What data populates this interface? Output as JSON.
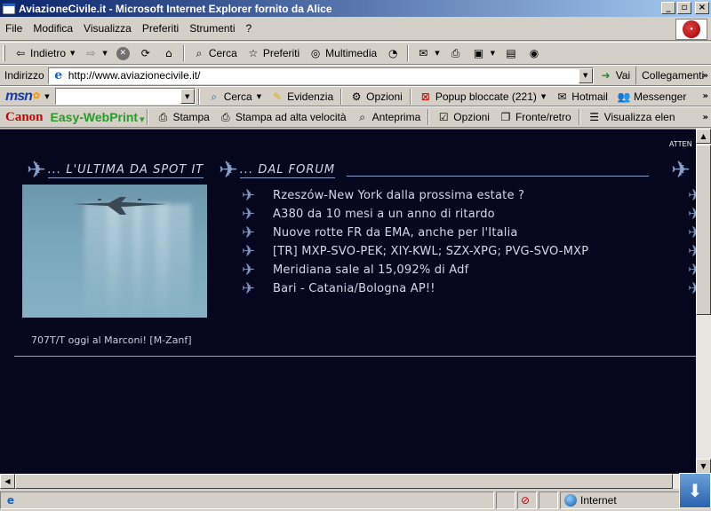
{
  "window": {
    "title": "AviazioneCivile.it - Microsoft Internet Explorer fornito da Alice",
    "controls": {
      "minimize": "_",
      "maximize": "▫",
      "close": "×"
    }
  },
  "menu": [
    "File",
    "Modifica",
    "Visualizza",
    "Preferiti",
    "Strumenti",
    "?"
  ],
  "std_toolbar": {
    "back": "Indietro",
    "search": "Cerca",
    "favorites": "Preferiti",
    "media": "Multimedia"
  },
  "address": {
    "label": "Indirizzo",
    "url": "http://www.aviazionecivile.it/",
    "go": "Vai",
    "links": "Collegamenti"
  },
  "msn_toolbar": {
    "logo": "msn",
    "search_value": "",
    "search": "Cerca",
    "highlight": "Evidenzia",
    "options": "Opzioni",
    "popup": "Popup bloccate (221)",
    "hotmail": "Hotmail",
    "messenger": "Messenger"
  },
  "canon_toolbar": {
    "logo": "Canon",
    "product": "Easy-WebPrint",
    "print": "Stampa",
    "fast_print": "Stampa ad alta velocità",
    "preview": "Anteprima",
    "options": "Opzioni",
    "duplex": "Fronte/retro",
    "view": "Visualizza elen"
  },
  "page": {
    "atten": "ATTEN",
    "spot_section": "... L'ultima da Spot it",
    "forum_section": "... Dal Forum",
    "spot_caption": "707T/T oggi al Marconi! [M-Zanf]",
    "forum_topics": [
      "Rzeszów-New York dalla prossima estate ?",
      "A380 da 10 mesi a un anno di ritardo",
      "Nuove rotte FR da EMA, anche per l'Italia",
      "[TR] MXP-SVO-PEK; XIY-KWL; SZX-XPG; PVG-SVO-MXP",
      "Meridiana sale al 15,092% di Adf",
      "Bari - Catania/Bologna AP!!"
    ]
  },
  "status": {
    "text": "",
    "zone": "Internet"
  },
  "colors": {
    "page_bg": "#06061e",
    "title_gradient_start": "#0a246a",
    "link_text": "#d2d8e8",
    "accent_plane": "#8aa0c8"
  }
}
